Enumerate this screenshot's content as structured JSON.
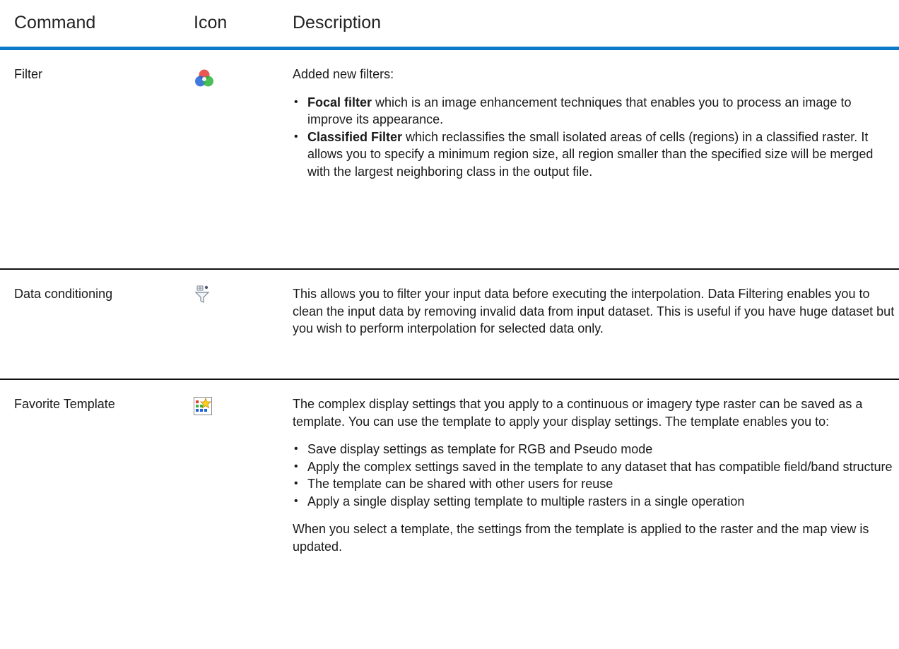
{
  "header": {
    "command": "Command",
    "icon": "Icon",
    "description": "Description"
  },
  "rows": [
    {
      "command": "Filter",
      "icon": "filter-color-circles-icon",
      "intro": "Added new filters:",
      "bullets": [
        {
          "term": "Focal filter",
          "text": " which is an image enhancement techniques that enables you to process an image to improve its appearance."
        },
        {
          "term": "Classified Filter",
          "text": " which reclassifies the small isolated areas of cells (regions) in a classified raster. It allows you to specify a minimum region size, all region smaller than the specified size will be merged with the largest neighboring class in the output file."
        }
      ]
    },
    {
      "command": "Data conditioning",
      "icon": "data-conditioning-funnel-icon",
      "text": "This allows you to filter your input data before executing the interpolation. Data Filtering enables you to clean the input data by removing invalid data from input dataset. This is useful if you have huge dataset but you wish to perform interpolation for selected data only."
    },
    {
      "command": "Favorite Template",
      "icon": "favorite-template-star-icon",
      "intro": "The complex display settings that you apply to a continuous or imagery type raster can be saved as a template. You can use the template to apply your display settings. The template enables you to:",
      "bullets": [
        "Save display settings as template for RGB and Pseudo mode",
        "Apply the complex settings saved in the template to any dataset that has compatible field/band structure",
        "The template can be shared with other users for reuse",
        "Apply a single display setting template to multiple rasters in a single operation"
      ],
      "outro": "When you select a template, the settings from the template is applied to the raster and the map view is updated."
    }
  ],
  "colors": {
    "header_rule": "#0a79c8",
    "row_rule": "#111111"
  }
}
